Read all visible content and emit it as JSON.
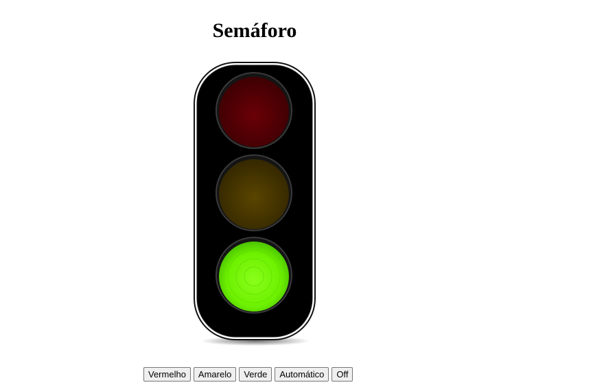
{
  "page": {
    "title": "Semáforo"
  },
  "traffic_light": {
    "active": "green",
    "lamps": {
      "red": {
        "on": false,
        "off_color": "#5c0004",
        "on_color": "#ff1a1a"
      },
      "yellow": {
        "on": false,
        "off_color": "#4a3a00",
        "on_color": "#ffcc00"
      },
      "green": {
        "on": true,
        "off_color": "#0e3a00",
        "on_color": "#7cff00"
      }
    }
  },
  "controls": {
    "red_label": "Vermelho",
    "yellow_label": "Amarelo",
    "green_label": "Verde",
    "auto_label": "Automático",
    "off_label": "Off"
  }
}
